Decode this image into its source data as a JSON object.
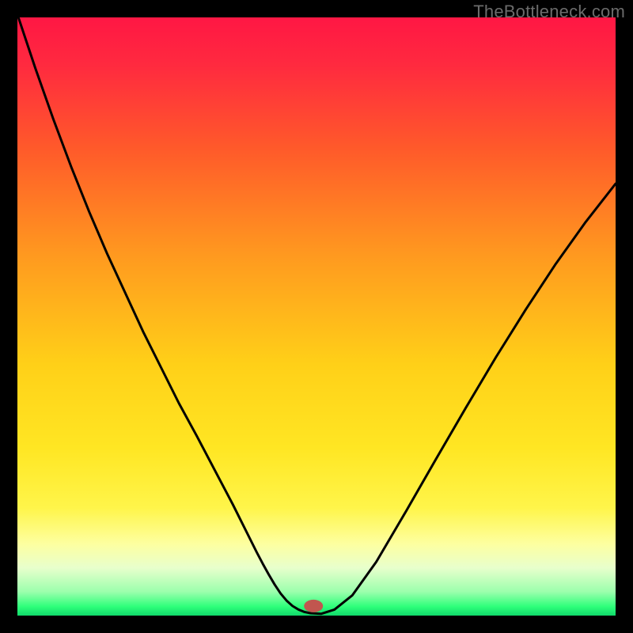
{
  "watermark": "TheBottleneck.com",
  "chart_data": {
    "type": "line",
    "title": "",
    "xlabel": "",
    "ylabel": "",
    "xlim": [
      0,
      1
    ],
    "ylim": [
      0,
      1
    ],
    "gradient_stops": [
      {
        "offset": 0.0,
        "color": "#ff1744"
      },
      {
        "offset": 0.08,
        "color": "#ff2a3f"
      },
      {
        "offset": 0.22,
        "color": "#ff5a2a"
      },
      {
        "offset": 0.4,
        "color": "#ff9a1f"
      },
      {
        "offset": 0.58,
        "color": "#ffd018"
      },
      {
        "offset": 0.72,
        "color": "#ffe623"
      },
      {
        "offset": 0.82,
        "color": "#fff54a"
      },
      {
        "offset": 0.88,
        "color": "#fdffa0"
      },
      {
        "offset": 0.92,
        "color": "#e8ffcc"
      },
      {
        "offset": 0.96,
        "color": "#9cffad"
      },
      {
        "offset": 0.985,
        "color": "#2eff7a"
      },
      {
        "offset": 1.0,
        "color": "#10d96b"
      }
    ],
    "series": [
      {
        "name": "curve",
        "x": [
          0.0,
          0.03,
          0.06,
          0.09,
          0.12,
          0.15,
          0.18,
          0.21,
          0.24,
          0.27,
          0.3,
          0.32,
          0.34,
          0.36,
          0.375,
          0.39,
          0.4,
          0.41,
          0.42,
          0.43,
          0.44,
          0.45,
          0.46,
          0.47,
          0.48,
          0.49,
          0.508,
          0.53,
          0.56,
          0.6,
          0.65,
          0.7,
          0.75,
          0.8,
          0.85,
          0.9,
          0.95,
          1.0
        ],
        "y": [
          1.005,
          0.915,
          0.83,
          0.75,
          0.675,
          0.605,
          0.54,
          0.475,
          0.415,
          0.355,
          0.3,
          0.262,
          0.224,
          0.186,
          0.156,
          0.126,
          0.106,
          0.087,
          0.069,
          0.052,
          0.037,
          0.025,
          0.016,
          0.01,
          0.006,
          0.004,
          0.003,
          0.01,
          0.034,
          0.09,
          0.175,
          0.262,
          0.348,
          0.432,
          0.512,
          0.588,
          0.658,
          0.722
        ]
      }
    ],
    "marker": {
      "x": 0.495,
      "y": 0.016,
      "color": "#c1564f",
      "rx": 12,
      "ry": 8
    }
  }
}
